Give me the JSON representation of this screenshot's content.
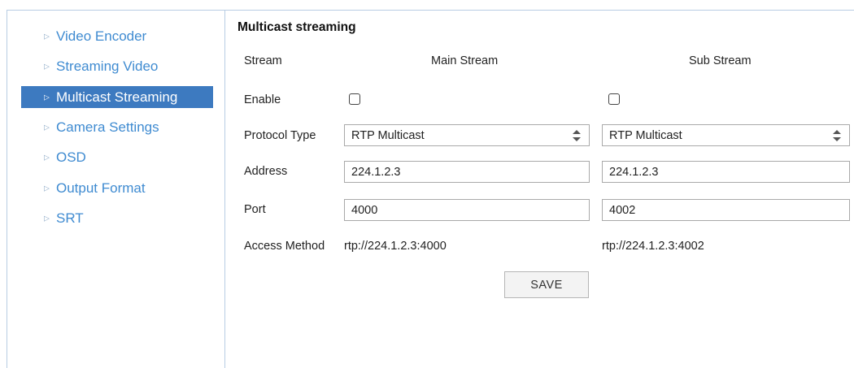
{
  "sidebar": {
    "items": [
      {
        "label": "Video Encoder",
        "active": false
      },
      {
        "label": "Streaming Video",
        "active": false
      },
      {
        "label": "Multicast Streaming",
        "active": true
      },
      {
        "label": "Camera Settings",
        "active": false
      },
      {
        "label": "OSD",
        "active": false
      },
      {
        "label": "Output Format",
        "active": false
      },
      {
        "label": "SRT",
        "active": false
      }
    ]
  },
  "main": {
    "title": "Multicast streaming",
    "labels": {
      "stream": "Stream",
      "enable": "Enable",
      "protocol_type": "Protocol Type",
      "address": "Address",
      "port": "Port",
      "access_method": "Access Method"
    },
    "main_stream": {
      "header": "Main Stream",
      "enabled": false,
      "protocol": "RTP Multicast",
      "address": "224.1.2.3",
      "port": "4000",
      "access_url": "rtp://224.1.2.3:4000"
    },
    "sub_stream": {
      "header": "Sub Stream",
      "enabled": false,
      "protocol": "RTP Multicast",
      "address": "224.1.2.3",
      "port": "4002",
      "access_url": "rtp://224.1.2.3:4002"
    },
    "save_label": "SAVE"
  },
  "colors": {
    "accent": "#3d7ac0",
    "link": "#3f8bd1",
    "border": "#b8cde3"
  }
}
